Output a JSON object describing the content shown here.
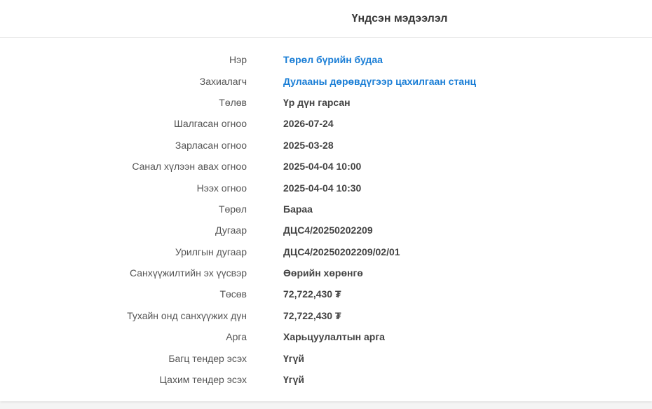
{
  "header": {
    "title": "Үндсэн мэдээлэл"
  },
  "colors": {
    "link": "#1a7ed6",
    "label": "#555555",
    "value": "#444444"
  },
  "details": [
    {
      "label": "Нэр",
      "value": "Төрөл бүрийн будаа",
      "link": true
    },
    {
      "label": "Захиалагч",
      "value": "Дулааны дөрөвдүгээр цахилгаан станц",
      "link": true
    },
    {
      "label": "Төлөв",
      "value": "Үр дүн гарсан"
    },
    {
      "label": "Шалгасан огноо",
      "value": "2026-07-24"
    },
    {
      "label": "Зарласан огноо",
      "value": "2025-03-28"
    },
    {
      "label": "Санал хүлээн авах огноо",
      "value": "2025-04-04 10:00"
    },
    {
      "label": "Нээх огноо",
      "value": "2025-04-04 10:30"
    },
    {
      "label": "Төрөл",
      "value": "Бараа"
    },
    {
      "label": "Дугаар",
      "value": "ДЦС4/20250202209"
    },
    {
      "label": "Урилгын дугаар",
      "value": "ДЦС4/20250202209/02/01"
    },
    {
      "label": "Санхүүжилтийн эх үүсвэр",
      "value": "Өөрийн хөрөнгө"
    },
    {
      "label": "Төсөв",
      "value": "72,722,430 ₮"
    },
    {
      "label": "Тухайн онд санхүүжих дүн",
      "value": "72,722,430 ₮"
    },
    {
      "label": "Арга",
      "value": "Харьцуулалтын арга"
    },
    {
      "label": "Багц тендер эсэх",
      "value": "Үгүй"
    },
    {
      "label": "Цахим тендер эсэх",
      "value": "Үгүй"
    }
  ]
}
